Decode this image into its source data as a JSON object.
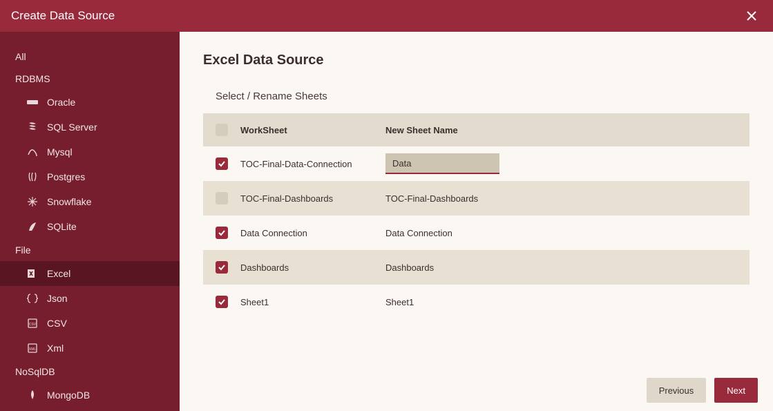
{
  "titlebar": {
    "title": "Create Data Source"
  },
  "sidebar": {
    "cat_all": "All",
    "cat_rdbms": "RDBMS",
    "rdbms": [
      {
        "label": "Oracle"
      },
      {
        "label": "SQL Server"
      },
      {
        "label": "Mysql"
      },
      {
        "label": "Postgres"
      },
      {
        "label": "Snowflake"
      },
      {
        "label": "SQLite"
      }
    ],
    "cat_file": "File",
    "file": [
      {
        "label": "Excel"
      },
      {
        "label": "Json"
      },
      {
        "label": "CSV"
      },
      {
        "label": "Xml"
      }
    ],
    "cat_nosql": "NoSqlDB",
    "nosql": [
      {
        "label": "MongoDB"
      }
    ]
  },
  "main": {
    "title": "Excel Data Source",
    "section": "Select / Rename Sheets",
    "headers": {
      "worksheet": "WorkSheet",
      "newname": "New Sheet Name"
    },
    "rows": [
      {
        "checked": true,
        "ws": "TOC-Final-Data-Connection",
        "name": "Data",
        "editing": true
      },
      {
        "checked": false,
        "ws": "TOC-Final-Dashboards",
        "name": "TOC-Final-Dashboards"
      },
      {
        "checked": true,
        "ws": "Data Connection",
        "name": "Data Connection"
      },
      {
        "checked": true,
        "ws": "Dashboards",
        "name": "Dashboards"
      },
      {
        "checked": true,
        "ws": "Sheet1",
        "name": "Sheet1"
      }
    ]
  },
  "footer": {
    "previous": "Previous",
    "next": "Next"
  }
}
